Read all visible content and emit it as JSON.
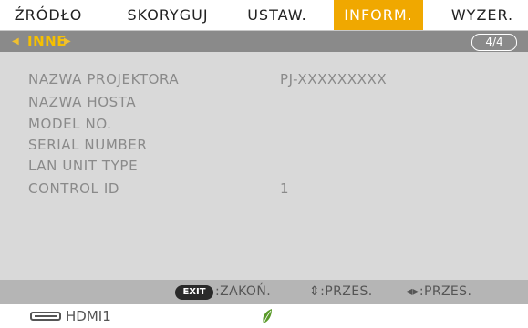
{
  "menu": {
    "tabs": [
      {
        "label": "ŹRÓDŁO",
        "active": false
      },
      {
        "label": "SKORYGUJ",
        "active": false
      },
      {
        "label": "USTAW.",
        "active": false
      },
      {
        "label": "INFORM.",
        "active": true
      },
      {
        "label": "WYZER.",
        "active": false
      }
    ],
    "active_color": "#f0a800"
  },
  "submenu": {
    "label": "INNE",
    "page_indicator": "4/4",
    "left_arrow_icon": "triangle-left-icon",
    "right_arrow_icon": "triangle-right-icon"
  },
  "info": {
    "rows": [
      {
        "label": "NAZWA PROJEKTORA",
        "value": "PJ-XXXXXXXXX"
      },
      {
        "label": "NAZWA HOSTA",
        "value": ""
      },
      {
        "label": "MODEL NO.",
        "value": ""
      },
      {
        "label": "SERIAL NUMBER",
        "value": ""
      },
      {
        "label": "LAN UNIT TYPE",
        "value": ""
      },
      {
        "label": "CONTROL ID",
        "value": "1"
      }
    ]
  },
  "footer": {
    "exit_key": "EXIT",
    "exit_action": ":ZAKOŃ.",
    "updown_action": "⇕:PRZES.",
    "leftright_action": "◂▸:PRZES."
  },
  "status": {
    "source": "HDMI1",
    "source_icon": "hdmi-connector-icon",
    "eco_icon": "leaf-icon",
    "eco_color": "#5a9a2a"
  }
}
